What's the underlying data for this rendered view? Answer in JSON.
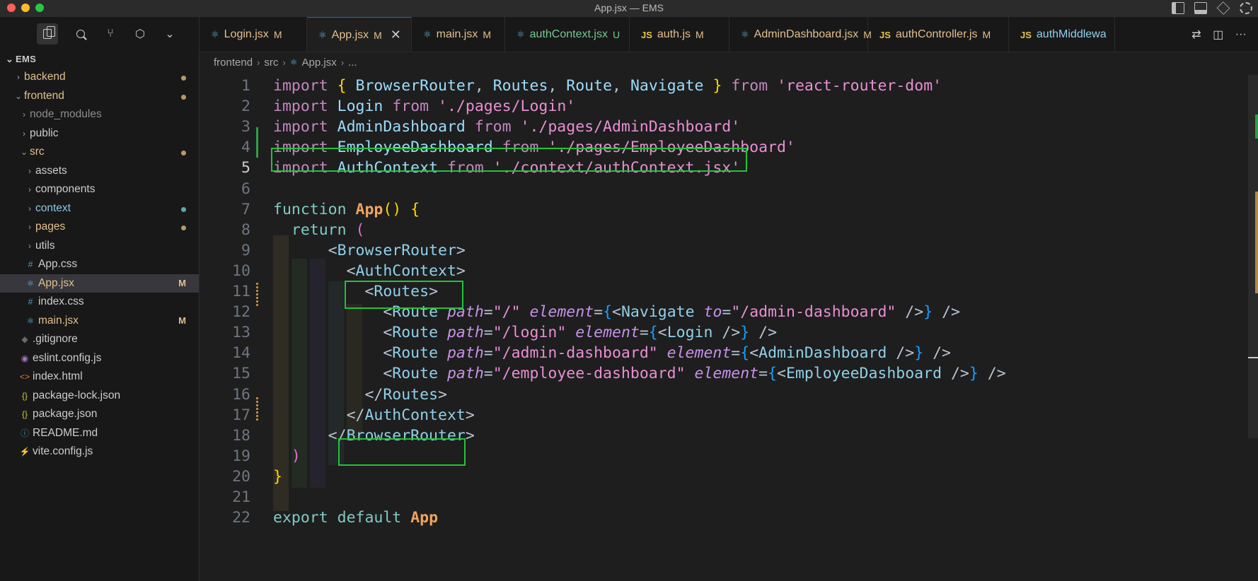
{
  "window": {
    "title": "App.jsx — EMS"
  },
  "sidebar": {
    "root_label": "EMS",
    "items": [
      {
        "label": "backend",
        "kind": "folder",
        "depth": 1,
        "state": "modified",
        "expanded": false
      },
      {
        "label": "frontend",
        "kind": "folder",
        "depth": 1,
        "state": "modified",
        "expanded": true
      },
      {
        "label": "node_modules",
        "kind": "folder",
        "depth": 2,
        "state": "ignored",
        "expanded": false
      },
      {
        "label": "public",
        "kind": "folder",
        "depth": 2,
        "state": "plain",
        "expanded": false
      },
      {
        "label": "src",
        "kind": "folder",
        "depth": 2,
        "state": "modified",
        "expanded": true
      },
      {
        "label": "assets",
        "kind": "folder",
        "depth": 3,
        "state": "plain",
        "expanded": false
      },
      {
        "label": "components",
        "kind": "folder",
        "depth": 3,
        "state": "plain",
        "expanded": false
      },
      {
        "label": "context",
        "kind": "folder",
        "depth": 3,
        "state": "context",
        "expanded": false
      },
      {
        "label": "pages",
        "kind": "folder",
        "depth": 3,
        "state": "modified",
        "expanded": false
      },
      {
        "label": "utils",
        "kind": "folder",
        "depth": 3,
        "state": "plain",
        "expanded": false
      },
      {
        "label": "App.css",
        "kind": "css",
        "depth": 3,
        "state": "plain",
        "icon": "#"
      },
      {
        "label": "App.jsx",
        "kind": "react",
        "depth": 3,
        "state": "modified",
        "badge": "M",
        "selected": true
      },
      {
        "label": "index.css",
        "kind": "css",
        "depth": 3,
        "state": "plain",
        "icon": "#"
      },
      {
        "label": "main.jsx",
        "kind": "react",
        "depth": 3,
        "state": "modified",
        "badge": "M"
      },
      {
        "label": ".gitignore",
        "kind": "git",
        "depth": 2,
        "state": "plain"
      },
      {
        "label": "eslint.config.js",
        "kind": "eslint",
        "depth": 2,
        "state": "plain"
      },
      {
        "label": "index.html",
        "kind": "html",
        "depth": 2,
        "state": "plain",
        "icon": "<>"
      },
      {
        "label": "package-lock.json",
        "kind": "json",
        "depth": 2,
        "state": "plain",
        "icon": "{}"
      },
      {
        "label": "package.json",
        "kind": "json",
        "depth": 2,
        "state": "plain",
        "icon": "{}"
      },
      {
        "label": "README.md",
        "kind": "info",
        "depth": 2,
        "state": "plain"
      },
      {
        "label": "vite.config.js",
        "kind": "vite",
        "depth": 2,
        "state": "plain"
      }
    ]
  },
  "tabs": [
    {
      "label": "Login.jsx",
      "status": "M",
      "icon": "react"
    },
    {
      "label": "App.jsx",
      "status": "M",
      "icon": "react",
      "active": true,
      "close": "✕"
    },
    {
      "label": "main.jsx",
      "status": "M",
      "icon": "react"
    },
    {
      "label": "authContext.jsx",
      "status": "U",
      "icon": "react"
    },
    {
      "label": "auth.js",
      "status": "M",
      "icon": "js"
    },
    {
      "label": "AdminDashboard.jsx",
      "status": "M",
      "icon": "react"
    },
    {
      "label": "authController.js",
      "status": "M",
      "icon": "js"
    },
    {
      "label": "authMiddlewa",
      "status": "",
      "icon": "js"
    }
  ],
  "tab_icon_js": "JS",
  "breadcrumb": {
    "parts": [
      "frontend",
      "src",
      "App.jsx",
      "..."
    ]
  },
  "editor": {
    "line_numbers": [
      "1",
      "2",
      "3",
      "4",
      "5",
      "6",
      "7",
      "8",
      "9",
      "10",
      "11",
      "12",
      "13",
      "14",
      "15",
      "16",
      "17",
      "18",
      "19",
      "20",
      "21",
      "22"
    ],
    "current_line": "5",
    "tok": {
      "import": "import",
      "from": "from",
      "function": "function",
      "return": "return",
      "export": "export",
      "default": "default",
      "open_brace": "{",
      "close_brace": "}",
      "open_paren": "(",
      "close_paren": ")",
      "parens": "()",
      "BrowserRouter": "BrowserRouter",
      "Routes": "Routes",
      "Route": "Route",
      "Navigate": "Navigate",
      "Login": "Login",
      "AdminDashboard": "AdminDashboard",
      "EmployeeDashboard": "EmployeeDashboard",
      "AuthContext": "AuthContext",
      "App": "App",
      "s_rrd": "'react-router-dom'",
      "s_login": "'./pages/Login'",
      "s_admin": "'./pages/AdminDashboard'",
      "s_emp": "'./pages/EmployeeDashboard'",
      "s_ctx": "'./context/authContext.jsx'",
      "path": "path",
      "element": "element",
      "to": "to",
      "p_root": "\"/\"",
      "p_login": "\"/login\"",
      "p_admin": "\"/admin-dashboard\"",
      "p_emp": "\"/employee-dashboard\"",
      "comma": ",",
      "eq": "=",
      "lt": "<",
      "gt": ">",
      "lts": "</",
      "sgt": " />",
      "sgt2": "/>"
    }
  },
  "colors": {
    "accent": "#0078d4",
    "highlight_box": "#22c33a",
    "modified": "#e2c08d",
    "untracked": "#73c991"
  }
}
